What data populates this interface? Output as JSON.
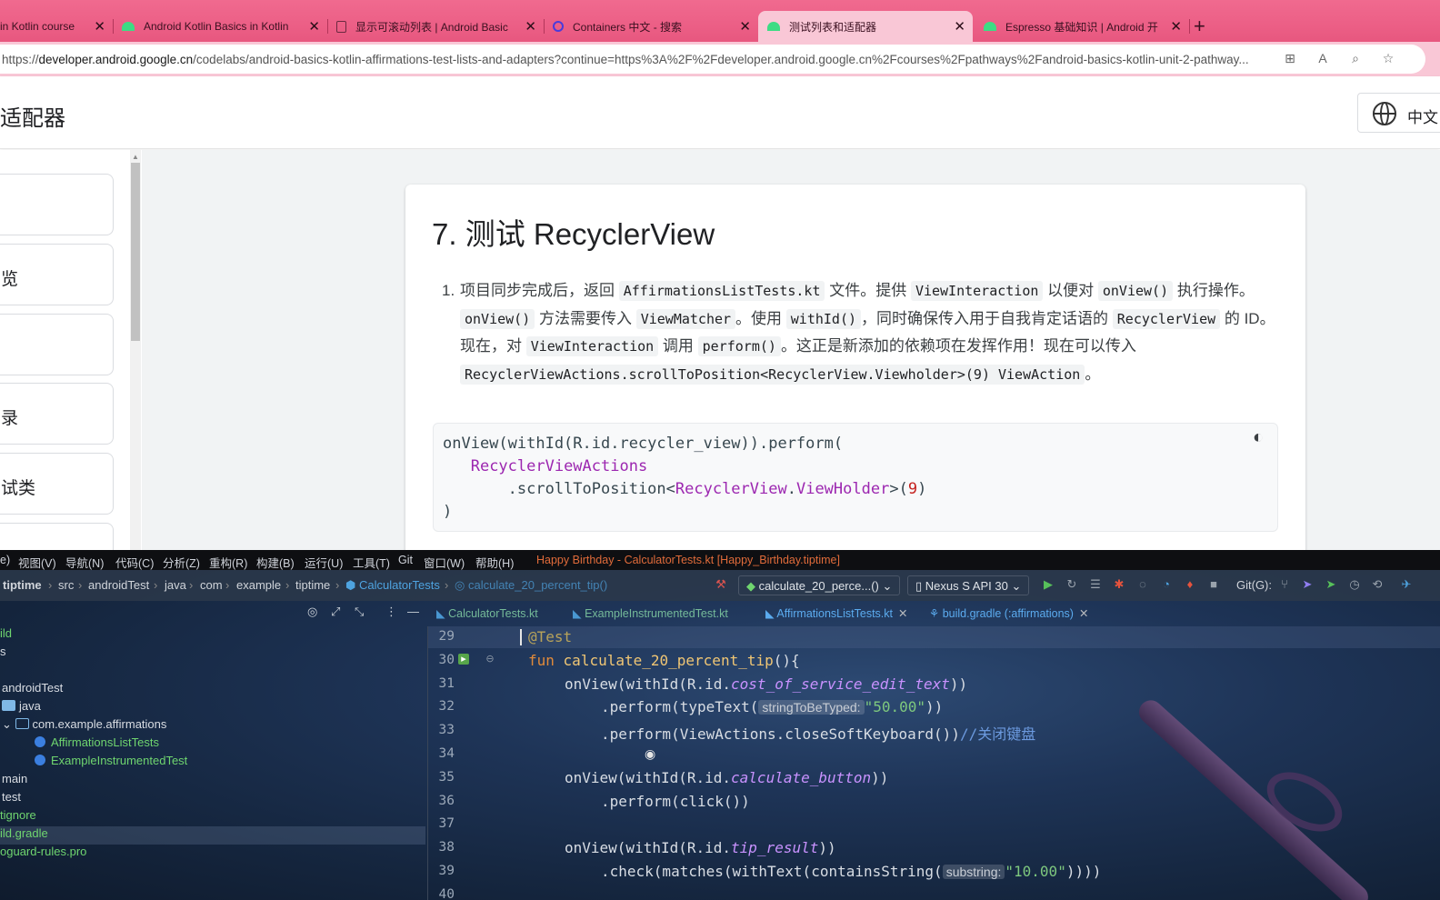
{
  "browser": {
    "tabs": [
      {
        "title": "in Kotlin course",
        "icon": "none"
      },
      {
        "title": "Android Kotlin Basics in Kotlin",
        "icon": "android-icon"
      },
      {
        "title": "显示可滚动列表 | Android Basic",
        "icon": "doc-icon"
      },
      {
        "title": "Containers 中文 - 搜索",
        "icon": "search-icon"
      },
      {
        "title": "测试列表和适配器",
        "icon": "android-icon"
      },
      {
        "title": "Espresso 基础知识 | Android 开",
        "icon": "android-icon"
      }
    ],
    "url_prefix": "https://",
    "url_domain": "developer.android.google.cn",
    "url_rest": "/codelabs/android-basics-kotlin-affirmations-test-lists-and-adapters?continue=https%3A%2F%2Fdeveloper.android.google.cn%2Fcourses%2Fpathways%2Fandroid-basics-kotlin-unit-2-pathway..."
  },
  "page": {
    "header_title": "适配器",
    "lang_label": "中文",
    "nav_cards": [
      "",
      "览",
      "",
      "录",
      "试类",
      ""
    ],
    "step_title": "7. 测试 RecyclerView",
    "step_num": "1.",
    "step_text": {
      "t1": "项目同步完成后，返回 ",
      "c1": "AffirmationsListTests.kt",
      "t2": " 文件。提供 ",
      "c2": "ViewInteraction",
      "t3": " 以便对 ",
      "c3": "onView()",
      "t4": " 执行操作。",
      "c4": "onView()",
      "t5": " 方法需要传入 ",
      "c5": "ViewMatcher",
      "t6": "。使用 ",
      "c6": "withId()",
      "t7": "，同时确保传入用于自我肯定话语的 ",
      "c7": "RecyclerView",
      "t8": " 的 ID。现在，对 ",
      "c8": "ViewInteraction",
      "t9": " 调用 ",
      "c9": "perform()",
      "t10": "。这正是新添加的依赖项在发挥作用！现在可以传入 ",
      "c10": "RecyclerViewActions.scrollToPosition<RecyclerView.Viewholder>(9) ViewAction",
      "t11": "。"
    },
    "code": {
      "l1": "onView(withId(R.id.recycler_view)).perform(",
      "l2": "RecyclerViewActions",
      "l3a": ".scrollToPosition<",
      "l3b": "RecyclerView",
      "l3c": ".",
      "l3d": "ViewHolder",
      "l3e": ">(",
      "l3f": "9",
      "l3g": ")",
      "l4": ")"
    }
  },
  "ide": {
    "menus": [
      "e)",
      "视图(V)",
      "导航(N)",
      "代码(C)",
      "分析(Z)",
      "重构(R)",
      "构建(B)",
      "运行(U)",
      "工具(T)",
      "Git",
      "窗口(W)",
      "帮助(H)"
    ],
    "title": "Happy Birthday - CalculatorTests.kt [Happy_Birthday.tiptime]",
    "breadcrumbs": [
      "tiptime",
      "src",
      "androidTest",
      "java",
      "com",
      "example",
      "tiptime",
      "CalculatorTests",
      "calculate_20_percent_tip()"
    ],
    "run_config": "calculate_20_perce...()",
    "device": "Nexus S API 30",
    "git_label": "Git(G):",
    "editor_tabs": [
      {
        "label": "CalculatorTests.kt"
      },
      {
        "label": "ExampleInstrumentedTest.kt"
      },
      {
        "label": "AffirmationsListTests.kt"
      },
      {
        "label": "build.gradle (:affirmations)"
      }
    ],
    "tree": [
      {
        "label": "ild",
        "type": "plain"
      },
      {
        "label": "s",
        "type": "plain"
      },
      {
        "label": "",
        "type": "plain"
      },
      {
        "label": "androidTest",
        "type": "plain"
      },
      {
        "label": "java",
        "type": "folder"
      },
      {
        "label": "com.example.affirmations",
        "type": "package"
      },
      {
        "label": "AffirmationsListTests",
        "type": "class"
      },
      {
        "label": "ExampleInstrumentedTest",
        "type": "class"
      },
      {
        "label": "main",
        "type": "plain"
      },
      {
        "label": "test",
        "type": "plain"
      },
      {
        "label": "tignore",
        "type": "green"
      },
      {
        "label": "ild.gradle",
        "type": "green"
      },
      {
        "label": "oguard-rules.pro",
        "type": "green"
      }
    ],
    "line_numbers": [
      "29",
      "30",
      "31",
      "32",
      "33",
      "34",
      "35",
      "36",
      "37",
      "38",
      "39",
      "40"
    ],
    "code": {
      "l29": "@Test",
      "l30_kw": "fun",
      "l30_fn": "calculate_20_percent_tip",
      "l30_rest": "(){",
      "l31_a": "onView(withId(R.id.",
      "l31_b": "cost_of_service_edit_text",
      "l31_c": "))",
      "l32_a": ".perform(typeText(",
      "l32_hint": "stringToBeTyped:",
      "l32_str": "\"50.00\"",
      "l32_c": "))",
      "l33_a": ".perform(ViewActions.closeSoftKeyboard())",
      "l33_cmt": "//关闭键盘",
      "l35_a": "onView(withId(R.id.",
      "l35_b": "calculate_button",
      "l35_c": "))",
      "l36": ".perform(click())",
      "l38_a": "onView(withId(R.id.",
      "l38_b": "tip_result",
      "l38_c": "))",
      "l39_a": ".check(matches(withText(containsString(",
      "l39_hint": "substring:",
      "l39_str": "\"10.00\"",
      "l39_c": "))))"
    }
  }
}
